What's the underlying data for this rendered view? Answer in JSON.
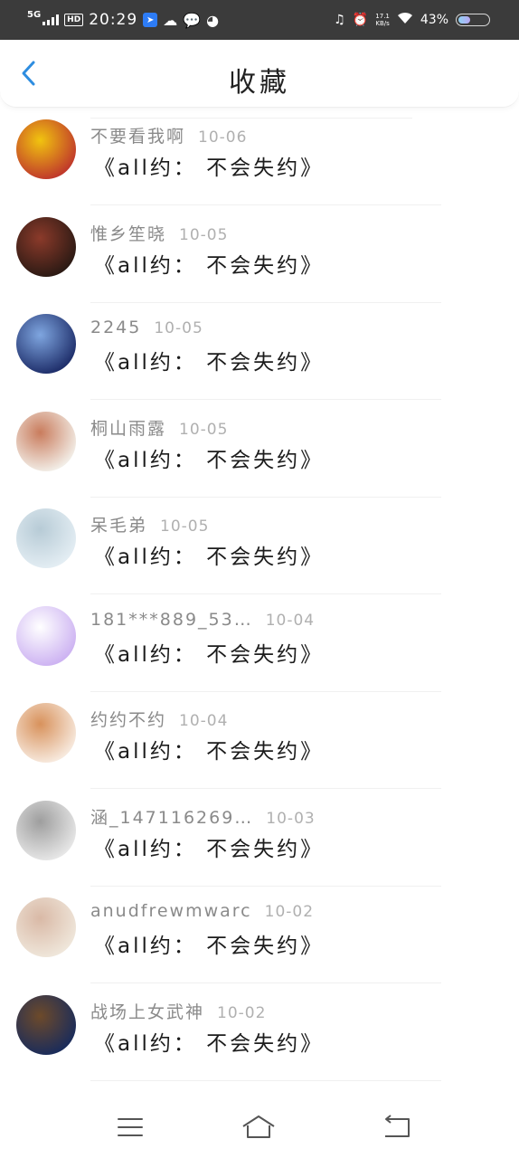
{
  "status_bar": {
    "network": "5G",
    "hd": "HD",
    "time": "20:29",
    "net_speed": "17.1",
    "net_unit": "KB/s",
    "battery": "43%",
    "battery_level": 0.43
  },
  "header": {
    "title": "收藏"
  },
  "items": [
    {
      "name": "不要看我啊",
      "date": "10-06",
      "content": "《all约： 不会失约》",
      "avatar_colors": [
        "#c0392b",
        "#f1c40f"
      ]
    },
    {
      "name": "惟乡笙晓",
      "date": "10-05",
      "content": "《all约： 不会失约》",
      "avatar_colors": [
        "#2c1a14",
        "#8b3a2a"
      ]
    },
    {
      "name": "2245",
      "date": "10-05",
      "content": "《all约： 不会失约》",
      "avatar_colors": [
        "#1f2f6b",
        "#7fa6e0"
      ]
    },
    {
      "name": "桐山雨露",
      "date": "10-05",
      "content": "《all约： 不会失约》",
      "avatar_colors": [
        "#f2ede6",
        "#c97c5d"
      ]
    },
    {
      "name": "呆毛弟",
      "date": "10-05",
      "content": "《all约： 不会失约》",
      "avatar_colors": [
        "#e3edf3",
        "#b7cbd6"
      ]
    },
    {
      "name": "181***889_53…",
      "date": "10-04",
      "content": "《all约： 不会失约》",
      "avatar_colors": [
        "#cdb3f2",
        "#ffffff"
      ]
    },
    {
      "name": "约约不约",
      "date": "10-04",
      "content": "《all约： 不会失约》",
      "avatar_colors": [
        "#f7e9dd",
        "#d8925c"
      ]
    },
    {
      "name": "涵_147116269…",
      "date": "10-03",
      "content": "《all约： 不会失约》",
      "avatar_colors": [
        "#e6e6e6",
        "#9e9e9e"
      ]
    },
    {
      "name": "anudfrewmwarc",
      "date": "10-02",
      "content": "《all约： 不会失约》",
      "avatar_colors": [
        "#efe6da",
        "#d9b9a6"
      ]
    },
    {
      "name": "战场上女武神",
      "date": "10-02",
      "content": "《all约： 不会失约》",
      "avatar_colors": [
        "#1b2c5a",
        "#6d4a2a"
      ]
    }
  ],
  "nav": {
    "menu_icon": "menu-icon",
    "home_icon": "home-icon",
    "back_icon": "back-icon"
  }
}
